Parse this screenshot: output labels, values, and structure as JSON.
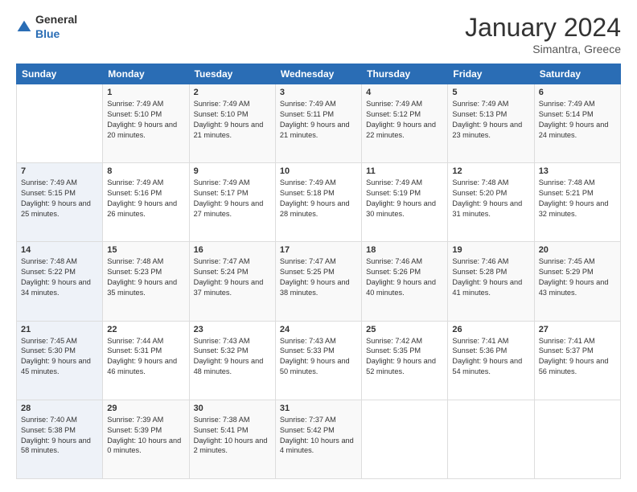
{
  "logo": {
    "general": "General",
    "blue": "Blue"
  },
  "header": {
    "month": "January 2024",
    "location": "Simantra, Greece"
  },
  "columns": [
    "Sunday",
    "Monday",
    "Tuesday",
    "Wednesday",
    "Thursday",
    "Friday",
    "Saturday"
  ],
  "weeks": [
    [
      {
        "day": "",
        "sunrise": "",
        "sunset": "",
        "daylight": ""
      },
      {
        "day": "1",
        "sunrise": "Sunrise: 7:49 AM",
        "sunset": "Sunset: 5:10 PM",
        "daylight": "Daylight: 9 hours and 20 minutes."
      },
      {
        "day": "2",
        "sunrise": "Sunrise: 7:49 AM",
        "sunset": "Sunset: 5:10 PM",
        "daylight": "Daylight: 9 hours and 21 minutes."
      },
      {
        "day": "3",
        "sunrise": "Sunrise: 7:49 AM",
        "sunset": "Sunset: 5:11 PM",
        "daylight": "Daylight: 9 hours and 21 minutes."
      },
      {
        "day": "4",
        "sunrise": "Sunrise: 7:49 AM",
        "sunset": "Sunset: 5:12 PM",
        "daylight": "Daylight: 9 hours and 22 minutes."
      },
      {
        "day": "5",
        "sunrise": "Sunrise: 7:49 AM",
        "sunset": "Sunset: 5:13 PM",
        "daylight": "Daylight: 9 hours and 23 minutes."
      },
      {
        "day": "6",
        "sunrise": "Sunrise: 7:49 AM",
        "sunset": "Sunset: 5:14 PM",
        "daylight": "Daylight: 9 hours and 24 minutes."
      }
    ],
    [
      {
        "day": "7",
        "sunrise": "Sunrise: 7:49 AM",
        "sunset": "Sunset: 5:15 PM",
        "daylight": "Daylight: 9 hours and 25 minutes."
      },
      {
        "day": "8",
        "sunrise": "Sunrise: 7:49 AM",
        "sunset": "Sunset: 5:16 PM",
        "daylight": "Daylight: 9 hours and 26 minutes."
      },
      {
        "day": "9",
        "sunrise": "Sunrise: 7:49 AM",
        "sunset": "Sunset: 5:17 PM",
        "daylight": "Daylight: 9 hours and 27 minutes."
      },
      {
        "day": "10",
        "sunrise": "Sunrise: 7:49 AM",
        "sunset": "Sunset: 5:18 PM",
        "daylight": "Daylight: 9 hours and 28 minutes."
      },
      {
        "day": "11",
        "sunrise": "Sunrise: 7:49 AM",
        "sunset": "Sunset: 5:19 PM",
        "daylight": "Daylight: 9 hours and 30 minutes."
      },
      {
        "day": "12",
        "sunrise": "Sunrise: 7:48 AM",
        "sunset": "Sunset: 5:20 PM",
        "daylight": "Daylight: 9 hours and 31 minutes."
      },
      {
        "day": "13",
        "sunrise": "Sunrise: 7:48 AM",
        "sunset": "Sunset: 5:21 PM",
        "daylight": "Daylight: 9 hours and 32 minutes."
      }
    ],
    [
      {
        "day": "14",
        "sunrise": "Sunrise: 7:48 AM",
        "sunset": "Sunset: 5:22 PM",
        "daylight": "Daylight: 9 hours and 34 minutes."
      },
      {
        "day": "15",
        "sunrise": "Sunrise: 7:48 AM",
        "sunset": "Sunset: 5:23 PM",
        "daylight": "Daylight: 9 hours and 35 minutes."
      },
      {
        "day": "16",
        "sunrise": "Sunrise: 7:47 AM",
        "sunset": "Sunset: 5:24 PM",
        "daylight": "Daylight: 9 hours and 37 minutes."
      },
      {
        "day": "17",
        "sunrise": "Sunrise: 7:47 AM",
        "sunset": "Sunset: 5:25 PM",
        "daylight": "Daylight: 9 hours and 38 minutes."
      },
      {
        "day": "18",
        "sunrise": "Sunrise: 7:46 AM",
        "sunset": "Sunset: 5:26 PM",
        "daylight": "Daylight: 9 hours and 40 minutes."
      },
      {
        "day": "19",
        "sunrise": "Sunrise: 7:46 AM",
        "sunset": "Sunset: 5:28 PM",
        "daylight": "Daylight: 9 hours and 41 minutes."
      },
      {
        "day": "20",
        "sunrise": "Sunrise: 7:45 AM",
        "sunset": "Sunset: 5:29 PM",
        "daylight": "Daylight: 9 hours and 43 minutes."
      }
    ],
    [
      {
        "day": "21",
        "sunrise": "Sunrise: 7:45 AM",
        "sunset": "Sunset: 5:30 PM",
        "daylight": "Daylight: 9 hours and 45 minutes."
      },
      {
        "day": "22",
        "sunrise": "Sunrise: 7:44 AM",
        "sunset": "Sunset: 5:31 PM",
        "daylight": "Daylight: 9 hours and 46 minutes."
      },
      {
        "day": "23",
        "sunrise": "Sunrise: 7:43 AM",
        "sunset": "Sunset: 5:32 PM",
        "daylight": "Daylight: 9 hours and 48 minutes."
      },
      {
        "day": "24",
        "sunrise": "Sunrise: 7:43 AM",
        "sunset": "Sunset: 5:33 PM",
        "daylight": "Daylight: 9 hours and 50 minutes."
      },
      {
        "day": "25",
        "sunrise": "Sunrise: 7:42 AM",
        "sunset": "Sunset: 5:35 PM",
        "daylight": "Daylight: 9 hours and 52 minutes."
      },
      {
        "day": "26",
        "sunrise": "Sunrise: 7:41 AM",
        "sunset": "Sunset: 5:36 PM",
        "daylight": "Daylight: 9 hours and 54 minutes."
      },
      {
        "day": "27",
        "sunrise": "Sunrise: 7:41 AM",
        "sunset": "Sunset: 5:37 PM",
        "daylight": "Daylight: 9 hours and 56 minutes."
      }
    ],
    [
      {
        "day": "28",
        "sunrise": "Sunrise: 7:40 AM",
        "sunset": "Sunset: 5:38 PM",
        "daylight": "Daylight: 9 hours and 58 minutes."
      },
      {
        "day": "29",
        "sunrise": "Sunrise: 7:39 AM",
        "sunset": "Sunset: 5:39 PM",
        "daylight": "Daylight: 10 hours and 0 minutes."
      },
      {
        "day": "30",
        "sunrise": "Sunrise: 7:38 AM",
        "sunset": "Sunset: 5:41 PM",
        "daylight": "Daylight: 10 hours and 2 minutes."
      },
      {
        "day": "31",
        "sunrise": "Sunrise: 7:37 AM",
        "sunset": "Sunset: 5:42 PM",
        "daylight": "Daylight: 10 hours and 4 minutes."
      },
      {
        "day": "",
        "sunrise": "",
        "sunset": "",
        "daylight": ""
      },
      {
        "day": "",
        "sunrise": "",
        "sunset": "",
        "daylight": ""
      },
      {
        "day": "",
        "sunrise": "",
        "sunset": "",
        "daylight": ""
      }
    ]
  ]
}
